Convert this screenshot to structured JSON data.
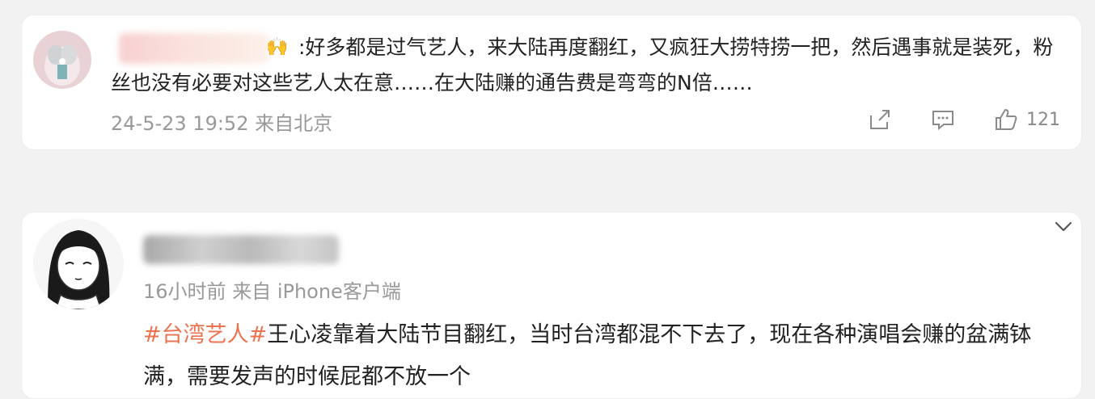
{
  "comment": {
    "text": ":好多都是过气艺人，来大陆再度翻红，又疯狂大捞特捞一把，然后遇事就是装死，粉丝也没有必要对这些艺人太在意……在大陆赚的通告费是弯弯的N倍……",
    "timestamp": "24-5-23 19:52",
    "location": "来自北京",
    "like_count": "121",
    "icons": [
      "share-icon",
      "comment-icon",
      "like-icon"
    ]
  },
  "post": {
    "time": "16小时前",
    "source": "来自 iPhone客户端",
    "hashtag": "#台湾艺人#",
    "text": "王心凌靠着大陆节目翻红，当时台湾都混不下去了，现在各种演唱会赚的盆满钵满，需要发声的时候屁都不放一个"
  },
  "colors": {
    "hashtag": "#eb7350",
    "meta": "#999999",
    "text": "#222222"
  }
}
